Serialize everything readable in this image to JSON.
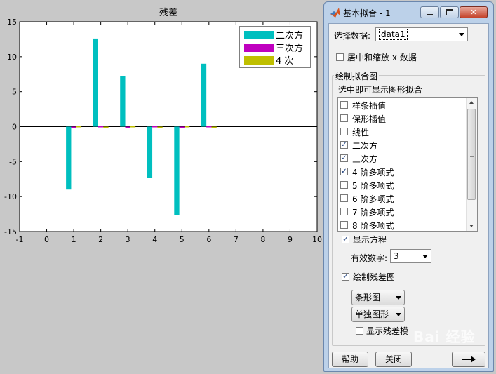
{
  "chart_data": {
    "type": "bar",
    "title": "残差",
    "xlim": [
      -1,
      10
    ],
    "ylim": [
      -15,
      15
    ],
    "xticks": [
      -1,
      0,
      1,
      2,
      3,
      4,
      5,
      6,
      7,
      8,
      9,
      10
    ],
    "yticks": [
      15,
      10,
      5,
      0,
      -5,
      -10,
      -15
    ],
    "x": [
      1,
      2,
      3,
      4,
      5,
      6
    ],
    "series": [
      {
        "name": "二次方",
        "color": "#00bfbf",
        "values": [
          -9.0,
          12.6,
          7.2,
          -7.3,
          -12.6,
          9.0
        ]
      },
      {
        "name": "三次方",
        "color": "#bf00bf",
        "values": [
          -0.05,
          0.05,
          -0.05,
          0.05,
          -0.05,
          0.05
        ]
      },
      {
        "name": "4 次",
        "color": "#bfbf00",
        "values": [
          0.05,
          -0.05,
          0.05,
          -0.05,
          0.05,
          -0.05
        ]
      }
    ],
    "legend": "top-right",
    "grid": false
  },
  "dialog": {
    "title": "基本拟合 - 1",
    "icon": "matlab-logo-icon",
    "minimize_icon": "minimize-icon",
    "maximize_icon": "maximize-icon",
    "close_icon": "close-icon",
    "select_data_label": "选择数据:",
    "select_data_value": "data1",
    "center_scale_label": "居中和缩放 x 数据",
    "center_scale_checked": false,
    "plot_fits_group": "绘制拟合图",
    "plot_fits_hint": "选中即可显示图形拟合",
    "fit_items": [
      {
        "label": "样条插值",
        "checked": false
      },
      {
        "label": "保形插值",
        "checked": false
      },
      {
        "label": "线性",
        "checked": false
      },
      {
        "label": "二次方",
        "checked": true
      },
      {
        "label": "三次方",
        "checked": true
      },
      {
        "label": "4 阶多项式",
        "checked": true
      },
      {
        "label": "5 阶多项式",
        "checked": false
      },
      {
        "label": "6 阶多项式",
        "checked": false
      },
      {
        "label": "7 阶多项式",
        "checked": false
      },
      {
        "label": "8 阶多项式",
        "checked": false
      }
    ],
    "show_equations_label": "显示方程",
    "show_equations_checked": true,
    "sig_digits_label": "有效数字:",
    "sig_digits_value": "3",
    "plot_residuals_label": "绘制残差图",
    "plot_residuals_checked": true,
    "residual_plot_type": "条形图",
    "residual_plot_location": "单独图形",
    "show_residual_norm_label": "显示残差模",
    "show_residual_norm_checked": false,
    "help_button": "帮助",
    "close_button": "关闭",
    "next_icon": "arrow-right-icon",
    "watermark": "Bai 经验"
  }
}
